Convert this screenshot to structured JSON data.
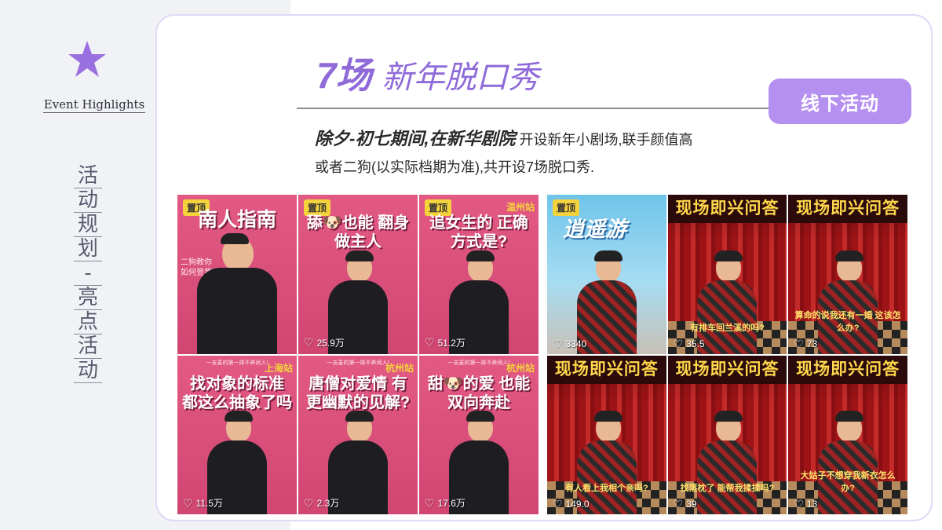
{
  "sidebar": {
    "event_highlights": "Event Highlights",
    "vertical_title": [
      "活",
      "动",
      "规",
      "划",
      "-",
      "亮",
      "点",
      "活",
      "动"
    ],
    "star_icon": "star-icon",
    "accent_color": "#9a6fe0"
  },
  "header": {
    "count": "7场",
    "title": "新年脱口秀",
    "tag_button": "线下活动"
  },
  "description": {
    "bold": "除夕-初七期间,在新华剧院",
    "rest": "开设新年小剧场,联手颜值高",
    "line2": "或者二狗(以实际档期为准),共开设7场脱口秀."
  },
  "left_grid": [
    {
      "pinned": "置顶",
      "city": "",
      "strip": "",
      "title": "南人指南",
      "side": "二狗教你\n如何登第一排",
      "likes": "",
      "icon": "heart-icon"
    },
    {
      "pinned": "置顶",
      "city": "",
      "strip": "",
      "title": "舔🐶也能 翻身做主人",
      "side": "",
      "likes": "25.9万",
      "icon": "heart-icon"
    },
    {
      "pinned": "置顶",
      "city": "温州站",
      "strip": "",
      "title": "追女生的 正确方式是?",
      "side": "",
      "likes": "51.2万",
      "icon": "heart-icon"
    },
    {
      "pinned": "",
      "city": "上海站",
      "strip": "一支麦的第一排不养闲人!",
      "title": "找对象的标准 都这么抽象了吗",
      "side": "",
      "likes": "11.5万",
      "icon": "heart-icon"
    },
    {
      "pinned": "",
      "city": "杭州站",
      "strip": "一支麦的第一排不养闲人!",
      "title": "唐僧对爱情 有更幽默的见解?",
      "side": "",
      "likes": "2.3万",
      "icon": "heart-icon"
    },
    {
      "pinned": "",
      "city": "杭州站",
      "strip": "一支麦的第一排不养闲人!",
      "title": "甜🐶的爱 也能双向奔赴",
      "side": "",
      "likes": "17.6万",
      "icon": "heart-icon"
    }
  ],
  "right_grid": [
    {
      "type": "travel",
      "pinned": "置顶",
      "title": "逍遥游",
      "caption": "",
      "likes": "3340",
      "icon": "heart-icon"
    },
    {
      "type": "stage",
      "pinned": "",
      "title": "现场即兴问答",
      "caption": "有排车回兰溪的吗?",
      "likes": "35.5",
      "icon": "heart-icon"
    },
    {
      "type": "stage",
      "pinned": "",
      "title": "现场即兴问答",
      "caption": "算命的说我还有一婚 这该怎么办?",
      "likes": "73",
      "icon": "heart-icon"
    },
    {
      "type": "stage",
      "pinned": "",
      "title": "现场即兴问答",
      "caption": "有人看上我相个亲吗?",
      "likes": "149.0",
      "icon": "heart-icon"
    },
    {
      "type": "stage",
      "pinned": "",
      "title": "现场即兴问答",
      "caption": "找落枕了 能帮我揉揉吗?",
      "likes": "39",
      "icon": "heart-icon"
    },
    {
      "type": "stage",
      "pinned": "",
      "title": "现场即兴问答",
      "caption": "大姑子不想穿我新衣怎么办?",
      "likes": "13",
      "icon": "heart-icon"
    }
  ]
}
